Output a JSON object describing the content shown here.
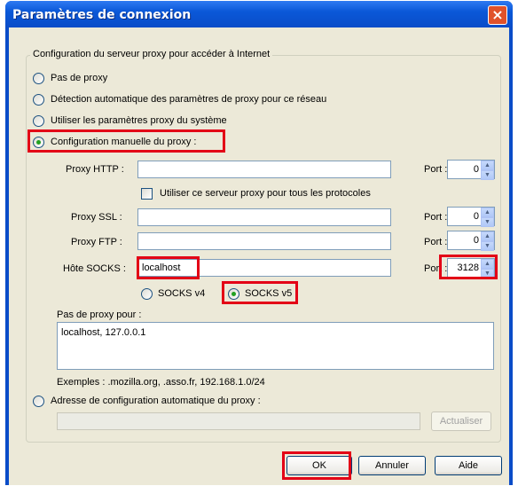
{
  "window": {
    "title": "Paramètres de connexion"
  },
  "group": {
    "legend": "Configuration du serveur proxy pour accéder à Internet"
  },
  "proxy_options": {
    "none": "Pas de proxy",
    "auto_detect": "Détection automatique des paramètres de proxy pour ce réseau",
    "system": "Utiliser les paramètres proxy du système",
    "manual": "Configuration manuelle du proxy :"
  },
  "selected_option": "manual",
  "http": {
    "label": "Proxy HTTP :",
    "value": "",
    "port_label": "Port :",
    "port": "0"
  },
  "use_for_all": {
    "label": "Utiliser ce serveur proxy pour tous les protocoles",
    "checked": false
  },
  "ssl": {
    "label": "Proxy SSL :",
    "value": "",
    "port_label": "Port :",
    "port": "0"
  },
  "ftp": {
    "label": "Proxy FTP :",
    "value": "",
    "port_label": "Port :",
    "port": "0"
  },
  "socks": {
    "label": "Hôte SOCKS :",
    "value": "localhost",
    "port_label": "Port :",
    "port": "3128",
    "v4": "SOCKS v4",
    "v5": "SOCKS v5",
    "selected": "v5"
  },
  "no_proxy": {
    "label": "Pas de proxy pour :",
    "value": "localhost, 127.0.0.1",
    "examples": "Exemples : .mozilla.org, .asso.fr, 192.168.1.0/24"
  },
  "auto_config": {
    "label": "Adresse de configuration automatique du proxy :",
    "value": "",
    "reload": "Actualiser"
  },
  "buttons": {
    "ok": "OK",
    "cancel": "Annuler",
    "help": "Aide"
  },
  "icons": {
    "close": "close-icon",
    "spin_up": "spin-up-icon",
    "spin_down": "spin-down-icon"
  },
  "colors": {
    "titlebar": "#0a4cc8",
    "dialog": "#ece9d8",
    "highlight": "#e30016",
    "radio_dot": "#21a121"
  }
}
